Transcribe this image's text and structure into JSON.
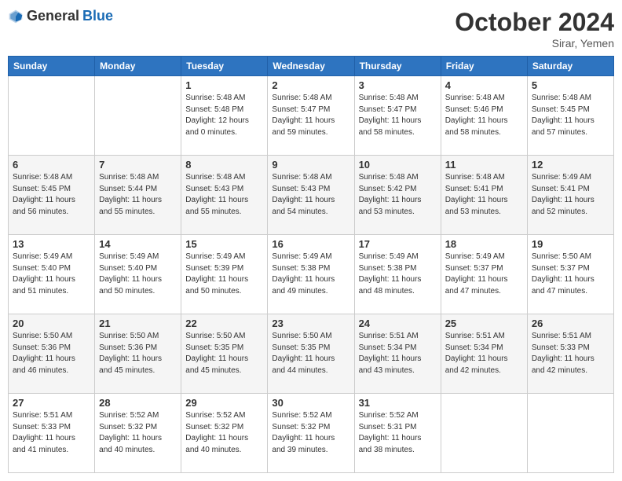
{
  "header": {
    "logo_general": "General",
    "logo_blue": "Blue",
    "month_title": "October 2024",
    "location": "Sirar, Yemen"
  },
  "days_of_week": [
    "Sunday",
    "Monday",
    "Tuesday",
    "Wednesday",
    "Thursday",
    "Friday",
    "Saturday"
  ],
  "weeks": [
    [
      {
        "day": "",
        "sunrise": "",
        "sunset": "",
        "daylight": ""
      },
      {
        "day": "",
        "sunrise": "",
        "sunset": "",
        "daylight": ""
      },
      {
        "day": "1",
        "sunrise": "Sunrise: 5:48 AM",
        "sunset": "Sunset: 5:48 PM",
        "daylight": "Daylight: 12 hours and 0 minutes."
      },
      {
        "day": "2",
        "sunrise": "Sunrise: 5:48 AM",
        "sunset": "Sunset: 5:47 PM",
        "daylight": "Daylight: 11 hours and 59 minutes."
      },
      {
        "day": "3",
        "sunrise": "Sunrise: 5:48 AM",
        "sunset": "Sunset: 5:47 PM",
        "daylight": "Daylight: 11 hours and 58 minutes."
      },
      {
        "day": "4",
        "sunrise": "Sunrise: 5:48 AM",
        "sunset": "Sunset: 5:46 PM",
        "daylight": "Daylight: 11 hours and 58 minutes."
      },
      {
        "day": "5",
        "sunrise": "Sunrise: 5:48 AM",
        "sunset": "Sunset: 5:45 PM",
        "daylight": "Daylight: 11 hours and 57 minutes."
      }
    ],
    [
      {
        "day": "6",
        "sunrise": "Sunrise: 5:48 AM",
        "sunset": "Sunset: 5:45 PM",
        "daylight": "Daylight: 11 hours and 56 minutes."
      },
      {
        "day": "7",
        "sunrise": "Sunrise: 5:48 AM",
        "sunset": "Sunset: 5:44 PM",
        "daylight": "Daylight: 11 hours and 55 minutes."
      },
      {
        "day": "8",
        "sunrise": "Sunrise: 5:48 AM",
        "sunset": "Sunset: 5:43 PM",
        "daylight": "Daylight: 11 hours and 55 minutes."
      },
      {
        "day": "9",
        "sunrise": "Sunrise: 5:48 AM",
        "sunset": "Sunset: 5:43 PM",
        "daylight": "Daylight: 11 hours and 54 minutes."
      },
      {
        "day": "10",
        "sunrise": "Sunrise: 5:48 AM",
        "sunset": "Sunset: 5:42 PM",
        "daylight": "Daylight: 11 hours and 53 minutes."
      },
      {
        "day": "11",
        "sunrise": "Sunrise: 5:48 AM",
        "sunset": "Sunset: 5:41 PM",
        "daylight": "Daylight: 11 hours and 53 minutes."
      },
      {
        "day": "12",
        "sunrise": "Sunrise: 5:49 AM",
        "sunset": "Sunset: 5:41 PM",
        "daylight": "Daylight: 11 hours and 52 minutes."
      }
    ],
    [
      {
        "day": "13",
        "sunrise": "Sunrise: 5:49 AM",
        "sunset": "Sunset: 5:40 PM",
        "daylight": "Daylight: 11 hours and 51 minutes."
      },
      {
        "day": "14",
        "sunrise": "Sunrise: 5:49 AM",
        "sunset": "Sunset: 5:40 PM",
        "daylight": "Daylight: 11 hours and 50 minutes."
      },
      {
        "day": "15",
        "sunrise": "Sunrise: 5:49 AM",
        "sunset": "Sunset: 5:39 PM",
        "daylight": "Daylight: 11 hours and 50 minutes."
      },
      {
        "day": "16",
        "sunrise": "Sunrise: 5:49 AM",
        "sunset": "Sunset: 5:38 PM",
        "daylight": "Daylight: 11 hours and 49 minutes."
      },
      {
        "day": "17",
        "sunrise": "Sunrise: 5:49 AM",
        "sunset": "Sunset: 5:38 PM",
        "daylight": "Daylight: 11 hours and 48 minutes."
      },
      {
        "day": "18",
        "sunrise": "Sunrise: 5:49 AM",
        "sunset": "Sunset: 5:37 PM",
        "daylight": "Daylight: 11 hours and 47 minutes."
      },
      {
        "day": "19",
        "sunrise": "Sunrise: 5:50 AM",
        "sunset": "Sunset: 5:37 PM",
        "daylight": "Daylight: 11 hours and 47 minutes."
      }
    ],
    [
      {
        "day": "20",
        "sunrise": "Sunrise: 5:50 AM",
        "sunset": "Sunset: 5:36 PM",
        "daylight": "Daylight: 11 hours and 46 minutes."
      },
      {
        "day": "21",
        "sunrise": "Sunrise: 5:50 AM",
        "sunset": "Sunset: 5:36 PM",
        "daylight": "Daylight: 11 hours and 45 minutes."
      },
      {
        "day": "22",
        "sunrise": "Sunrise: 5:50 AM",
        "sunset": "Sunset: 5:35 PM",
        "daylight": "Daylight: 11 hours and 45 minutes."
      },
      {
        "day": "23",
        "sunrise": "Sunrise: 5:50 AM",
        "sunset": "Sunset: 5:35 PM",
        "daylight": "Daylight: 11 hours and 44 minutes."
      },
      {
        "day": "24",
        "sunrise": "Sunrise: 5:51 AM",
        "sunset": "Sunset: 5:34 PM",
        "daylight": "Daylight: 11 hours and 43 minutes."
      },
      {
        "day": "25",
        "sunrise": "Sunrise: 5:51 AM",
        "sunset": "Sunset: 5:34 PM",
        "daylight": "Daylight: 11 hours and 42 minutes."
      },
      {
        "day": "26",
        "sunrise": "Sunrise: 5:51 AM",
        "sunset": "Sunset: 5:33 PM",
        "daylight": "Daylight: 11 hours and 42 minutes."
      }
    ],
    [
      {
        "day": "27",
        "sunrise": "Sunrise: 5:51 AM",
        "sunset": "Sunset: 5:33 PM",
        "daylight": "Daylight: 11 hours and 41 minutes."
      },
      {
        "day": "28",
        "sunrise": "Sunrise: 5:52 AM",
        "sunset": "Sunset: 5:32 PM",
        "daylight": "Daylight: 11 hours and 40 minutes."
      },
      {
        "day": "29",
        "sunrise": "Sunrise: 5:52 AM",
        "sunset": "Sunset: 5:32 PM",
        "daylight": "Daylight: 11 hours and 40 minutes."
      },
      {
        "day": "30",
        "sunrise": "Sunrise: 5:52 AM",
        "sunset": "Sunset: 5:32 PM",
        "daylight": "Daylight: 11 hours and 39 minutes."
      },
      {
        "day": "31",
        "sunrise": "Sunrise: 5:52 AM",
        "sunset": "Sunset: 5:31 PM",
        "daylight": "Daylight: 11 hours and 38 minutes."
      },
      {
        "day": "",
        "sunrise": "",
        "sunset": "",
        "daylight": ""
      },
      {
        "day": "",
        "sunrise": "",
        "sunset": "",
        "daylight": ""
      }
    ]
  ]
}
